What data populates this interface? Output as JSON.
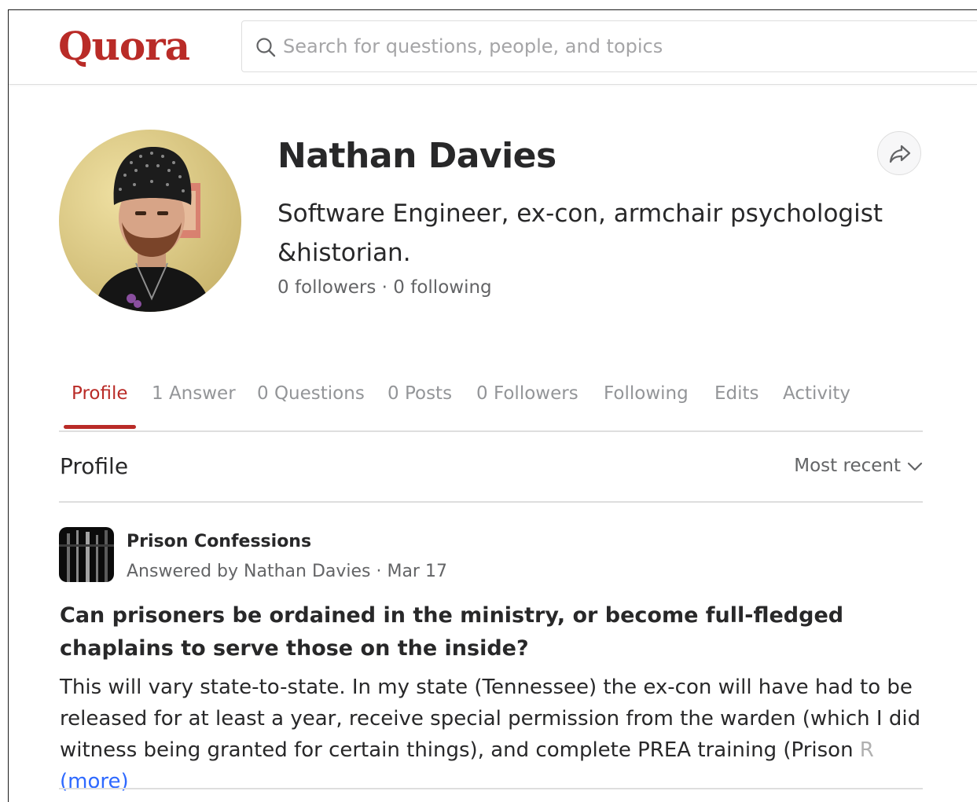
{
  "header": {
    "logo": "Quora",
    "search_placeholder": "Search for questions, people, and topics",
    "brand_color": "#b92b27"
  },
  "profile": {
    "name": "Nathan Davies",
    "bio": "Software Engineer, ex-con, armchair psychologist &historian.",
    "stats": "0 followers · 0 following",
    "share_icon": "share-arrow-icon"
  },
  "tabs": [
    {
      "label": "Profile",
      "active": true
    },
    {
      "label": "1 Answer"
    },
    {
      "label": "0 Questions"
    },
    {
      "label": "0 Posts"
    },
    {
      "label": "0 Followers"
    },
    {
      "label": "Following"
    },
    {
      "label": "Edits"
    },
    {
      "label": "Activity"
    }
  ],
  "section": {
    "title": "Profile",
    "sort_label": "Most recent"
  },
  "feed": [
    {
      "space": "Prison Confessions",
      "meta": "Answered by Nathan Davies · Mar 17",
      "question": "Can prisoners be ordained in the ministry, or become full-fledged chaplains to serve those on the inside?",
      "answer_text": "This will vary state-to-state. In my state (Tennessee) the ex-con will have had to be released for at least a year, receive special permission from the warden (which I did witness being granted for certain things), and complete PREA training (Prison",
      "answer_fade": " R",
      "more_label": "(more)"
    }
  ]
}
